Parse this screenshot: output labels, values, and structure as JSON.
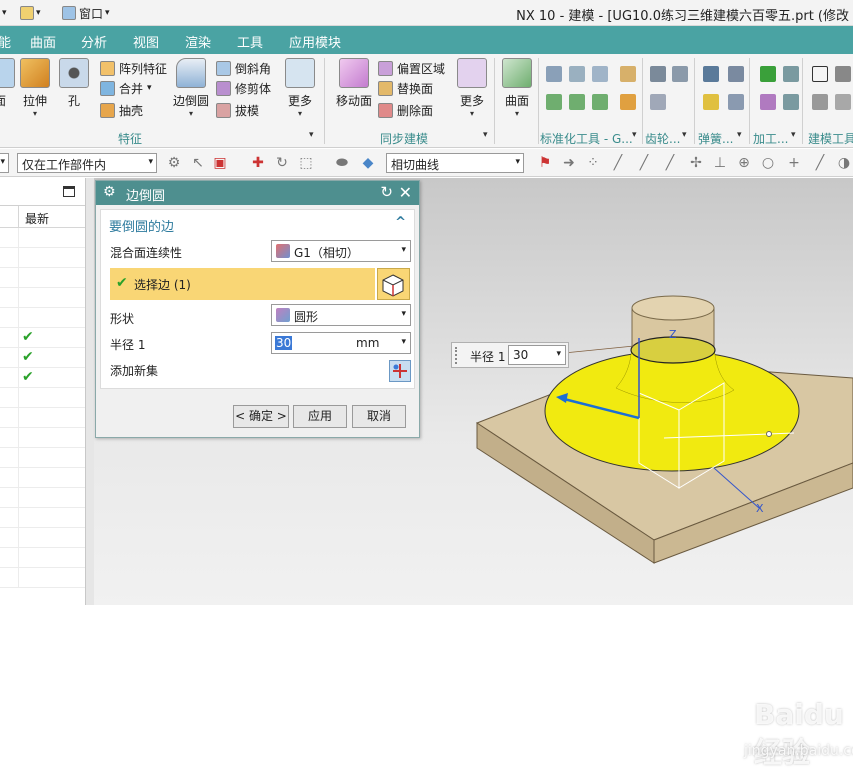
{
  "titlebar": {
    "window_menu_label": "窗口",
    "title": "NX 10 - 建模 - [UG10.0练习三维建模六百零五.prt  (修改"
  },
  "menu_tabs": [
    "能",
    "曲面",
    "分析",
    "视图",
    "渲染",
    "工具",
    "应用模块"
  ],
  "ribbon": {
    "big_buttons": {
      "face_partial": "面",
      "extrude": "拉伸",
      "hole": "孔",
      "edge_blend": "边倒圆",
      "more1": "更多",
      "move_face": "移动面",
      "more2": "更多",
      "surface": "曲面"
    },
    "small_buttons": {
      "pattern_feature": "阵列特征",
      "unite": "合并",
      "shell": "抽壳",
      "chamfer": "倒斜角",
      "trim_body": "修剪体",
      "draft": "拔模",
      "offset_region": "偏置区域",
      "replace_face": "替换面",
      "delete_face": "删除面"
    },
    "groups": {
      "feature": "特征",
      "sync_modeling": "同步建模",
      "standard_tools": "标准化工具 - G...",
      "gear": "齿轮...",
      "spring": "弹簧...",
      "machining": "加工...",
      "modeling_tools": "建模工具"
    }
  },
  "selection_bar": {
    "filter_scope": "仅在工作部件内",
    "curve_rule": "相切曲线"
  },
  "navigator": {
    "col_latest": "最新",
    "rows_checked": [
      false,
      false,
      false,
      false,
      false,
      true,
      true,
      true,
      false,
      false,
      false,
      false,
      false,
      false,
      false,
      false,
      false,
      false
    ]
  },
  "dialog": {
    "title": "边倒圆",
    "section_title": "要倒圆的边",
    "blend_continuity_label": "混合面连续性",
    "blend_continuity_value": "G1（相切）",
    "select_edge": "选择边 (1)",
    "shape_label": "形状",
    "shape_value": "圆形",
    "radius_label": "半径 1",
    "radius_value": "30",
    "radius_unit": "mm",
    "add_new_set_label": "添加新集",
    "ok_button": "< 确定 >",
    "apply_button": "应用",
    "cancel_button": "取消"
  },
  "callout": {
    "label": "半径 1",
    "value": "30"
  },
  "watermark": {
    "brand": "Baidu经验",
    "url": "jingyan.baidu.com"
  },
  "colors": {
    "menu_teal": "#4aa3a3",
    "dialog_title": "#4e8f8f",
    "selection_yellow": "#f9d675",
    "blend_yellow": "#f1ea10",
    "block_tan": "#d8c7a3"
  }
}
